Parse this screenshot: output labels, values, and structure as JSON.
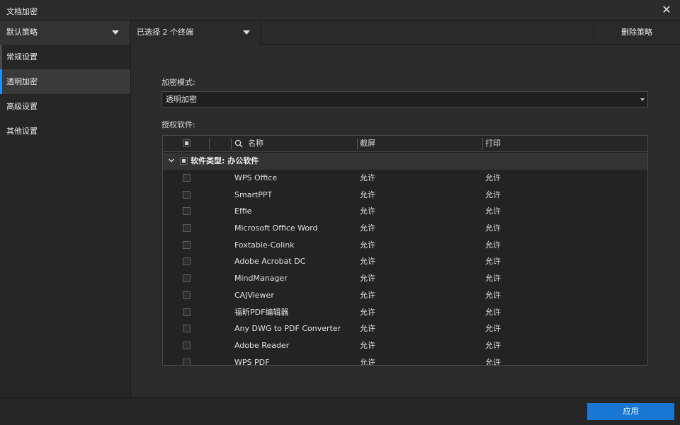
{
  "window": {
    "title": "文档加密"
  },
  "toolbar": {
    "policy": "默认策略",
    "terminals": "已选择 2 个终端",
    "delete_label": "删除策略"
  },
  "sidebar": {
    "items": [
      {
        "label": "常规设置"
      },
      {
        "label": "透明加密"
      },
      {
        "label": "高级设置"
      },
      {
        "label": "其他设置"
      }
    ],
    "active_index": 1
  },
  "main": {
    "mode_label": "加密模式:",
    "mode_value": "透明加密",
    "software_label": "授权软件:"
  },
  "table": {
    "headers": {
      "name": "名称",
      "screenshot": "截屏",
      "print": "打印"
    },
    "group": {
      "label": "软件类型: 办公软件"
    },
    "rows": [
      {
        "name": "WPS Office",
        "screenshot": "允许",
        "print": "允许"
      },
      {
        "name": "SmartPPT",
        "screenshot": "允许",
        "print": "允许"
      },
      {
        "name": "Effie",
        "screenshot": "允许",
        "print": "允许"
      },
      {
        "name": "Microsoft Office Word",
        "screenshot": "允许",
        "print": "允许"
      },
      {
        "name": "Foxtable-Colink",
        "screenshot": "允许",
        "print": "允许"
      },
      {
        "name": "Adobe Acrobat DC",
        "screenshot": "允许",
        "print": "允许"
      },
      {
        "name": "MindManager",
        "screenshot": "允许",
        "print": "允许"
      },
      {
        "name": "CAJViewer",
        "screenshot": "允许",
        "print": "允许"
      },
      {
        "name": "福昕PDF编辑器",
        "screenshot": "允许",
        "print": "允许"
      },
      {
        "name": "Any DWG to PDF Converter",
        "screenshot": "允许",
        "print": "允许"
      },
      {
        "name": "Adobe Reader",
        "screenshot": "允许",
        "print": "允许"
      },
      {
        "name": "WPS PDF",
        "screenshot": "允许",
        "print": "允许"
      }
    ]
  },
  "footer": {
    "apply_label": "应用"
  },
  "colors": {
    "accent": "#1877d2",
    "nav_indicator": "#1e90ff",
    "background": "#2b2b2b"
  },
  "icons": {
    "close": "close-icon",
    "search": "search-icon",
    "group_toggle": "chevron-down-icon",
    "dropdown": "caret-down-icon"
  }
}
